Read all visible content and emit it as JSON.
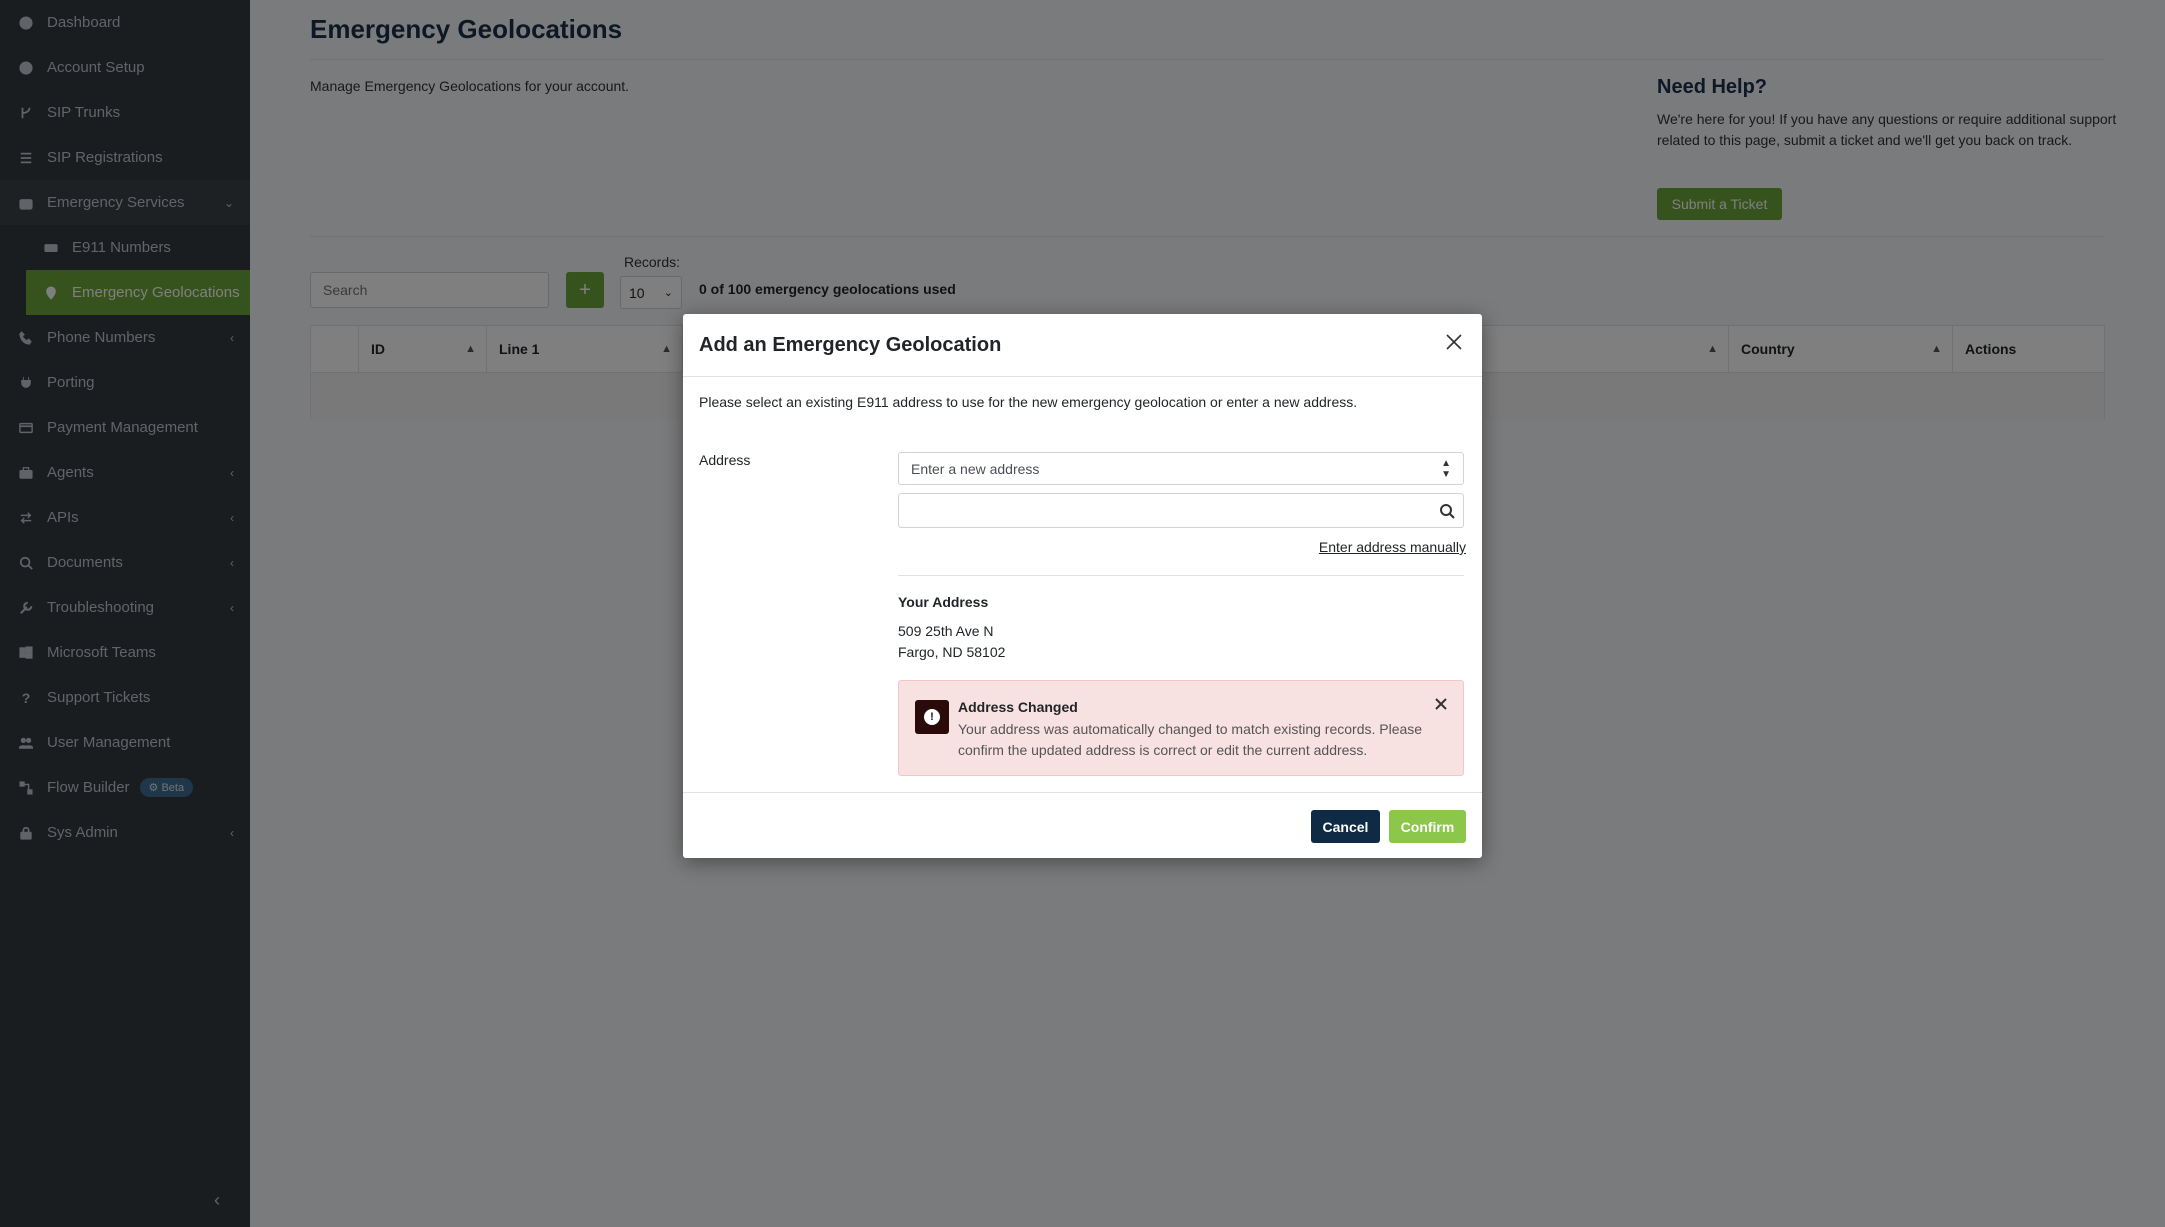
{
  "sidebar": {
    "items": [
      {
        "label": "Dashboard",
        "icon": "dashboard-icon"
      },
      {
        "label": "Account Setup",
        "icon": "user-circle-icon"
      },
      {
        "label": "SIP Trunks",
        "icon": "branch-icon"
      },
      {
        "label": "SIP Registrations",
        "icon": "list-icon"
      },
      {
        "label": "Emergency Services",
        "icon": "medical-bag-icon"
      },
      {
        "label": "E911 Numbers",
        "icon": "ambulance-icon"
      },
      {
        "label": "Emergency Geolocations",
        "icon": "map-pin-icon"
      },
      {
        "label": "Phone Numbers",
        "icon": "phone-icon"
      },
      {
        "label": "Porting",
        "icon": "plug-icon"
      },
      {
        "label": "Payment Management",
        "icon": "credit-card-icon"
      },
      {
        "label": "Agents",
        "icon": "briefcase-icon"
      },
      {
        "label": "APIs",
        "icon": "exchange-icon"
      },
      {
        "label": "Documents",
        "icon": "search-icon"
      },
      {
        "label": "Troubleshooting",
        "icon": "wrench-icon"
      },
      {
        "label": "Microsoft Teams",
        "icon": "windows-icon"
      },
      {
        "label": "Support Tickets",
        "icon": "question-icon"
      },
      {
        "label": "User Management",
        "icon": "users-icon"
      },
      {
        "label": "Flow Builder",
        "icon": "flow-icon",
        "badge": "Beta"
      },
      {
        "label": "Sys Admin",
        "icon": "lock-icon"
      }
    ]
  },
  "page": {
    "title": "Emergency Geolocations",
    "description": "Manage Emergency Geolocations for your account."
  },
  "help": {
    "title": "Need Help?",
    "text": "We're here for you! If you have any questions or require additional support related to this page, submit a ticket and we'll get you back on track.",
    "button": "Submit a Ticket"
  },
  "toolbar": {
    "search_placeholder": "Search",
    "add_label": "+",
    "records_label": "Records:",
    "records_value": "10",
    "used_text": "0 of 100 emergency geolocations used"
  },
  "table": {
    "columns": [
      "ID",
      "Line 1",
      "Country",
      "Actions"
    ]
  },
  "modal": {
    "title": "Add an Emergency Geolocation",
    "intro": "Please select an existing E911 address to use for the new emergency geolocation or enter a new address.",
    "address_label": "Address",
    "address_select_value": "Enter a new address",
    "search_value": "",
    "manual_link": "Enter address manually",
    "your_address_label": "Your Address",
    "address_line1": "509 25th Ave N",
    "address_line2": "Fargo, ND 58102",
    "alert": {
      "title": "Address Changed",
      "text": "Your address was automatically changed to match existing records. Please confirm the updated address is correct or edit the current address."
    },
    "cancel_label": "Cancel",
    "confirm_label": "Confirm"
  },
  "colors": {
    "sidebar_bg": "#343a40",
    "accent_green": "#6fa63a",
    "confirm_green": "#8cc64b",
    "cancel_navy": "#0f2a44",
    "alert_bg": "#f8e1e1"
  }
}
